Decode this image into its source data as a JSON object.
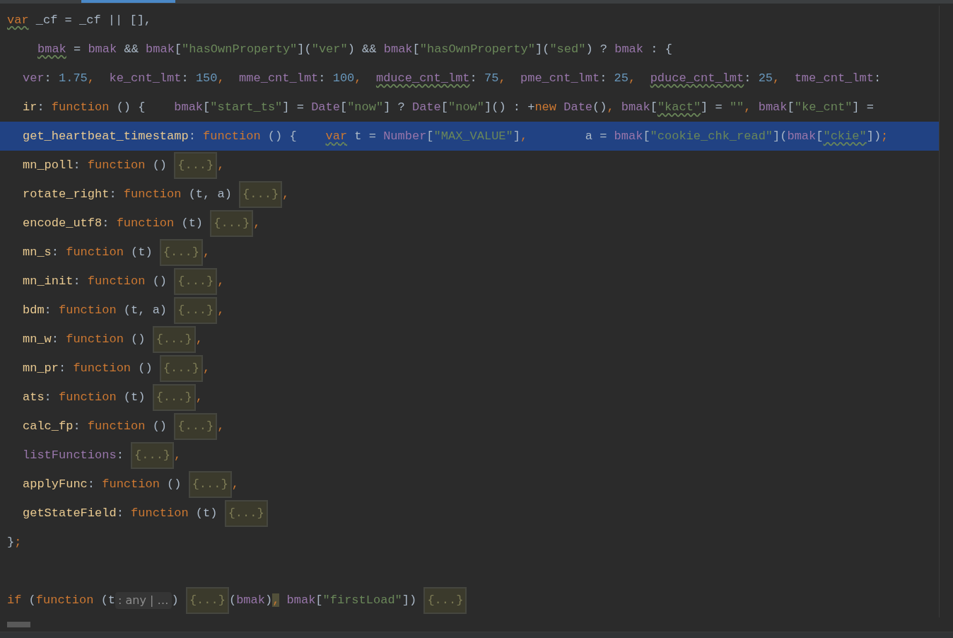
{
  "editor": {
    "lines": [
      {
        "kind": "outer",
        "selected": false,
        "tokens": [
          {
            "text": "var",
            "kind": "keyword",
            "warn": true
          },
          {
            "text": " _cf = _cf || [],",
            "kind": "plain",
            "warn": false
          }
        ]
      },
      {
        "kind": "continuation",
        "selected": false,
        "tokens": [
          {
            "text": "bmak",
            "kind": "ident",
            "warn": true
          },
          {
            "text": " = ",
            "kind": "plain",
            "warn": false
          },
          {
            "text": "bmak",
            "kind": "ident",
            "warn": false
          },
          {
            "text": " && ",
            "kind": "plain",
            "warn": false
          },
          {
            "text": "bmak",
            "kind": "ident",
            "warn": false
          },
          {
            "text": "[",
            "kind": "plain",
            "warn": false
          },
          {
            "text": "\"hasOwnProperty\"",
            "kind": "string",
            "warn": false
          },
          {
            "text": "](",
            "kind": "plain",
            "warn": false
          },
          {
            "text": "\"ver\"",
            "kind": "string",
            "warn": false
          },
          {
            "text": ") && ",
            "kind": "plain",
            "warn": false
          },
          {
            "text": "bmak",
            "kind": "ident",
            "warn": false
          },
          {
            "text": "[",
            "kind": "plain",
            "warn": false
          },
          {
            "text": "\"hasOwnProperty\"",
            "kind": "string",
            "warn": false
          },
          {
            "text": "](",
            "kind": "plain",
            "warn": false
          },
          {
            "text": "\"sed\"",
            "kind": "string",
            "warn": false
          },
          {
            "text": ") ? ",
            "kind": "plain",
            "warn": false
          },
          {
            "text": "bmak",
            "kind": "ident",
            "warn": false
          },
          {
            "text": " : {",
            "kind": "plain",
            "warn": false
          }
        ]
      },
      {
        "kind": "member",
        "selected": false,
        "tokens": [
          {
            "text": "ver",
            "kind": "ident",
            "warn": false
          },
          {
            "text": ": ",
            "kind": "plain",
            "warn": false
          },
          {
            "text": "1.75",
            "kind": "number",
            "warn": false
          },
          {
            "text": ",  ",
            "kind": "keyword",
            "warn": false
          },
          {
            "text": "ke_cnt_lmt",
            "kind": "ident",
            "warn": false
          },
          {
            "text": ": ",
            "kind": "plain",
            "warn": false
          },
          {
            "text": "150",
            "kind": "number",
            "warn": false
          },
          {
            "text": ",  ",
            "kind": "keyword",
            "warn": false
          },
          {
            "text": "mme_cnt_lmt",
            "kind": "ident",
            "warn": false
          },
          {
            "text": ": ",
            "kind": "plain",
            "warn": false
          },
          {
            "text": "100",
            "kind": "number",
            "warn": false
          },
          {
            "text": ",  ",
            "kind": "keyword",
            "warn": false
          },
          {
            "text": "mduce_cnt_lmt",
            "kind": "ident",
            "warn": true
          },
          {
            "text": ": ",
            "kind": "plain",
            "warn": false
          },
          {
            "text": "75",
            "kind": "number",
            "warn": false
          },
          {
            "text": ",  ",
            "kind": "keyword",
            "warn": false
          },
          {
            "text": "pme_cnt_lmt",
            "kind": "ident",
            "warn": false
          },
          {
            "text": ": ",
            "kind": "plain",
            "warn": false
          },
          {
            "text": "25",
            "kind": "number",
            "warn": false
          },
          {
            "text": ",  ",
            "kind": "keyword",
            "warn": false
          },
          {
            "text": "pduce_cnt_lmt",
            "kind": "ident",
            "warn": true
          },
          {
            "text": ": ",
            "kind": "plain",
            "warn": false
          },
          {
            "text": "25",
            "kind": "number",
            "warn": false
          },
          {
            "text": ",  ",
            "kind": "keyword",
            "warn": false
          },
          {
            "text": "tme_cnt_lmt",
            "kind": "ident",
            "warn": false
          },
          {
            "text": ":",
            "kind": "plain",
            "warn": false
          }
        ]
      },
      {
        "kind": "member",
        "selected": false,
        "tokens": [
          {
            "text": "ir",
            "kind": "prop",
            "warn": false
          },
          {
            "text": ": ",
            "kind": "plain",
            "warn": false
          },
          {
            "text": "function",
            "kind": "keyword",
            "warn": false
          },
          {
            "text": " () {    ",
            "kind": "plain",
            "warn": false
          },
          {
            "text": "bmak",
            "kind": "ident",
            "warn": false
          },
          {
            "text": "[",
            "kind": "plain",
            "warn": false
          },
          {
            "text": "\"start_ts\"",
            "kind": "string",
            "warn": false
          },
          {
            "text": "] = ",
            "kind": "plain",
            "warn": false
          },
          {
            "text": "Date",
            "kind": "ident",
            "warn": false
          },
          {
            "text": "[",
            "kind": "plain",
            "warn": false
          },
          {
            "text": "\"now\"",
            "kind": "string",
            "warn": false
          },
          {
            "text": "] ? ",
            "kind": "plain",
            "warn": false
          },
          {
            "text": "Date",
            "kind": "ident",
            "warn": false
          },
          {
            "text": "[",
            "kind": "plain",
            "warn": false
          },
          {
            "text": "\"now\"",
            "kind": "string",
            "warn": false
          },
          {
            "text": "]() : +",
            "kind": "plain",
            "warn": false
          },
          {
            "text": "new",
            "kind": "keyword",
            "warn": false
          },
          {
            "text": " Date",
            "kind": "ident",
            "warn": false
          },
          {
            "text": "()",
            "kind": "plain",
            "warn": false
          },
          {
            "text": ", ",
            "kind": "keyword",
            "warn": false
          },
          {
            "text": "bmak",
            "kind": "ident",
            "warn": false
          },
          {
            "text": "[",
            "kind": "plain",
            "warn": false
          },
          {
            "text": "\"kact\"",
            "kind": "string",
            "warn": true
          },
          {
            "text": "] = ",
            "kind": "plain",
            "warn": false
          },
          {
            "text": "\"\"",
            "kind": "string",
            "warn": false
          },
          {
            "text": ", ",
            "kind": "keyword",
            "warn": false
          },
          {
            "text": "bmak",
            "kind": "ident",
            "warn": false
          },
          {
            "text": "[",
            "kind": "plain",
            "warn": false
          },
          {
            "text": "\"ke_cnt\"",
            "kind": "string",
            "warn": false
          },
          {
            "text": "] =",
            "kind": "plain",
            "warn": false
          }
        ]
      },
      {
        "kind": "member",
        "selected": true,
        "tokens": [
          {
            "text": "get_heartbeat_timestamp",
            "kind": "prop",
            "warn": false
          },
          {
            "text": ": ",
            "kind": "plain",
            "warn": false
          },
          {
            "text": "function",
            "kind": "keyword",
            "warn": false
          },
          {
            "text": " () {    ",
            "kind": "plain",
            "warn": false
          },
          {
            "text": "var",
            "kind": "keyword",
            "warn": true
          },
          {
            "text": " t = ",
            "kind": "plain",
            "warn": false
          },
          {
            "text": "Number",
            "kind": "ident",
            "warn": false
          },
          {
            "text": "[",
            "kind": "plain",
            "warn": false
          },
          {
            "text": "\"MAX_VALUE\"",
            "kind": "string",
            "warn": false
          },
          {
            "text": "]",
            "kind": "plain",
            "warn": false
          },
          {
            "text": ",",
            "kind": "keyword",
            "warn": false
          },
          {
            "text": "        a = ",
            "kind": "plain",
            "warn": false
          },
          {
            "text": "bmak",
            "kind": "ident",
            "warn": false
          },
          {
            "text": "[",
            "kind": "plain",
            "warn": false
          },
          {
            "text": "\"cookie_chk_read\"",
            "kind": "string",
            "warn": false
          },
          {
            "text": "](",
            "kind": "plain",
            "warn": false
          },
          {
            "text": "bmak",
            "kind": "ident",
            "warn": false
          },
          {
            "text": "[",
            "kind": "plain",
            "warn": false
          },
          {
            "text": "\"ckie\"",
            "kind": "string",
            "warn": true
          },
          {
            "text": "])",
            "kind": "plain",
            "warn": false
          },
          {
            "text": ";",
            "kind": "keyword",
            "warn": false
          }
        ]
      },
      {
        "kind": "member",
        "selected": false,
        "tokens": [
          {
            "text": "mn_poll",
            "kind": "prop",
            "warn": false
          },
          {
            "text": ": ",
            "kind": "plain",
            "warn": false
          },
          {
            "text": "function",
            "kind": "keyword",
            "warn": false
          },
          {
            "text": " () ",
            "kind": "plain",
            "warn": false
          },
          {
            "text": "{...}",
            "kind": "fold",
            "warn": false
          },
          {
            "text": ",",
            "kind": "keyword",
            "warn": false
          }
        ]
      },
      {
        "kind": "member",
        "selected": false,
        "tokens": [
          {
            "text": "rotate_right",
            "kind": "prop",
            "warn": false
          },
          {
            "text": ": ",
            "kind": "plain",
            "warn": false
          },
          {
            "text": "function",
            "kind": "keyword",
            "warn": false
          },
          {
            "text": " (t, a) ",
            "kind": "plain",
            "warn": false
          },
          {
            "text": "{...}",
            "kind": "fold",
            "warn": false
          },
          {
            "text": ",",
            "kind": "keyword",
            "warn": false
          }
        ]
      },
      {
        "kind": "member",
        "selected": false,
        "tokens": [
          {
            "text": "encode_utf8",
            "kind": "prop",
            "warn": false
          },
          {
            "text": ": ",
            "kind": "plain",
            "warn": false
          },
          {
            "text": "function",
            "kind": "keyword",
            "warn": false
          },
          {
            "text": " (t) ",
            "kind": "plain",
            "warn": false
          },
          {
            "text": "{...}",
            "kind": "fold",
            "warn": false
          },
          {
            "text": ",",
            "kind": "keyword",
            "warn": false
          }
        ]
      },
      {
        "kind": "member",
        "selected": false,
        "tokens": [
          {
            "text": "mn_s",
            "kind": "prop",
            "warn": false
          },
          {
            "text": ": ",
            "kind": "plain",
            "warn": false
          },
          {
            "text": "function",
            "kind": "keyword",
            "warn": false
          },
          {
            "text": " (t) ",
            "kind": "plain",
            "warn": false
          },
          {
            "text": "{...}",
            "kind": "fold",
            "warn": false
          },
          {
            "text": ",",
            "kind": "keyword",
            "warn": false
          }
        ]
      },
      {
        "kind": "member",
        "selected": false,
        "tokens": [
          {
            "text": "mn_init",
            "kind": "prop",
            "warn": false
          },
          {
            "text": ": ",
            "kind": "plain",
            "warn": false
          },
          {
            "text": "function",
            "kind": "keyword",
            "warn": false
          },
          {
            "text": " () ",
            "kind": "plain",
            "warn": false
          },
          {
            "text": "{...}",
            "kind": "fold",
            "warn": false
          },
          {
            "text": ",",
            "kind": "keyword",
            "warn": false
          }
        ]
      },
      {
        "kind": "member",
        "selected": false,
        "tokens": [
          {
            "text": "bdm",
            "kind": "prop",
            "warn": false
          },
          {
            "text": ": ",
            "kind": "plain",
            "warn": false
          },
          {
            "text": "function",
            "kind": "keyword",
            "warn": false
          },
          {
            "text": " (t, a) ",
            "kind": "plain",
            "warn": false
          },
          {
            "text": "{...}",
            "kind": "fold",
            "warn": false
          },
          {
            "text": ",",
            "kind": "keyword",
            "warn": false
          }
        ]
      },
      {
        "kind": "member",
        "selected": false,
        "tokens": [
          {
            "text": "mn_w",
            "kind": "prop",
            "warn": false
          },
          {
            "text": ": ",
            "kind": "plain",
            "warn": false
          },
          {
            "text": "function",
            "kind": "keyword",
            "warn": false
          },
          {
            "text": " () ",
            "kind": "plain",
            "warn": false
          },
          {
            "text": "{...}",
            "kind": "fold",
            "warn": false
          },
          {
            "text": ",",
            "kind": "keyword",
            "warn": false
          }
        ]
      },
      {
        "kind": "member",
        "selected": false,
        "tokens": [
          {
            "text": "mn_pr",
            "kind": "prop",
            "warn": false
          },
          {
            "text": ": ",
            "kind": "plain",
            "warn": false
          },
          {
            "text": "function",
            "kind": "keyword",
            "warn": false
          },
          {
            "text": " () ",
            "kind": "plain",
            "warn": false
          },
          {
            "text": "{...}",
            "kind": "fold",
            "warn": false
          },
          {
            "text": ",",
            "kind": "keyword",
            "warn": false
          }
        ]
      },
      {
        "kind": "member",
        "selected": false,
        "tokens": [
          {
            "text": "ats",
            "kind": "prop",
            "warn": false
          },
          {
            "text": ": ",
            "kind": "plain",
            "warn": false
          },
          {
            "text": "function",
            "kind": "keyword",
            "warn": false
          },
          {
            "text": " (t) ",
            "kind": "plain",
            "warn": false
          },
          {
            "text": "{...}",
            "kind": "fold",
            "warn": false
          },
          {
            "text": ",",
            "kind": "keyword",
            "warn": false
          }
        ]
      },
      {
        "kind": "member",
        "selected": false,
        "tokens": [
          {
            "text": "calc_fp",
            "kind": "prop",
            "warn": false
          },
          {
            "text": ": ",
            "kind": "plain",
            "warn": false
          },
          {
            "text": "function",
            "kind": "keyword",
            "warn": false
          },
          {
            "text": " () ",
            "kind": "plain",
            "warn": false
          },
          {
            "text": "{...}",
            "kind": "fold",
            "warn": false
          },
          {
            "text": ",",
            "kind": "keyword",
            "warn": false
          }
        ]
      },
      {
        "kind": "member",
        "selected": false,
        "tokens": [
          {
            "text": "listFunctions",
            "kind": "ident",
            "warn": false
          },
          {
            "text": ": ",
            "kind": "plain",
            "warn": false
          },
          {
            "text": "{...}",
            "kind": "fold",
            "warn": false
          },
          {
            "text": ",",
            "kind": "keyword",
            "warn": false
          }
        ]
      },
      {
        "kind": "member",
        "selected": false,
        "tokens": [
          {
            "text": "applyFunc",
            "kind": "prop",
            "warn": false
          },
          {
            "text": ": ",
            "kind": "plain",
            "warn": false
          },
          {
            "text": "function",
            "kind": "keyword",
            "warn": false
          },
          {
            "text": " () ",
            "kind": "plain",
            "warn": false
          },
          {
            "text": "{...}",
            "kind": "fold",
            "warn": false
          },
          {
            "text": ",",
            "kind": "keyword",
            "warn": false
          }
        ]
      },
      {
        "kind": "member",
        "selected": false,
        "tokens": [
          {
            "text": "getStateField",
            "kind": "prop",
            "warn": false
          },
          {
            "text": ": ",
            "kind": "plain",
            "warn": false
          },
          {
            "text": "function",
            "kind": "keyword",
            "warn": false
          },
          {
            "text": " (t) ",
            "kind": "plain",
            "warn": false
          },
          {
            "text": "{...}",
            "kind": "fold",
            "warn": false
          }
        ]
      },
      {
        "kind": "outer",
        "selected": false,
        "tokens": [
          {
            "text": "}",
            "kind": "plain",
            "warn": false
          },
          {
            "text": ";",
            "kind": "keyword",
            "warn": false
          }
        ]
      },
      {
        "kind": "outer",
        "selected": false
      },
      {
        "kind": "outer",
        "selected": false,
        "tokens": [
          {
            "text": "if",
            "kind": "keyword",
            "warn": false
          },
          {
            "text": " (",
            "kind": "plain",
            "warn": false
          },
          {
            "text": "function",
            "kind": "keyword",
            "warn": false
          },
          {
            "text": " (t",
            "kind": "plain",
            "warn": false
          },
          {
            "text": ": any | …",
            "kind": "hint",
            "warn": false
          },
          {
            "text": ") ",
            "kind": "plain",
            "warn": false
          },
          {
            "text": "{...}",
            "kind": "fold",
            "warn": false
          },
          {
            "text": "(",
            "kind": "plain",
            "warn": false
          },
          {
            "text": "bmak",
            "kind": "ident",
            "warn": false
          },
          {
            "text": ")",
            "kind": "plain",
            "warn": false
          },
          {
            "text": ",",
            "kind": "match",
            "warn": false
          },
          {
            "text": " bmak",
            "kind": "ident",
            "warn": false
          },
          {
            "text": "[",
            "kind": "plain",
            "warn": false
          },
          {
            "text": "\"firstLoad\"",
            "kind": "string",
            "warn": false
          },
          {
            "text": "]) ",
            "kind": "plain",
            "warn": false
          },
          {
            "text": "{...}",
            "kind": "fold",
            "warn": false
          }
        ]
      }
    ]
  }
}
